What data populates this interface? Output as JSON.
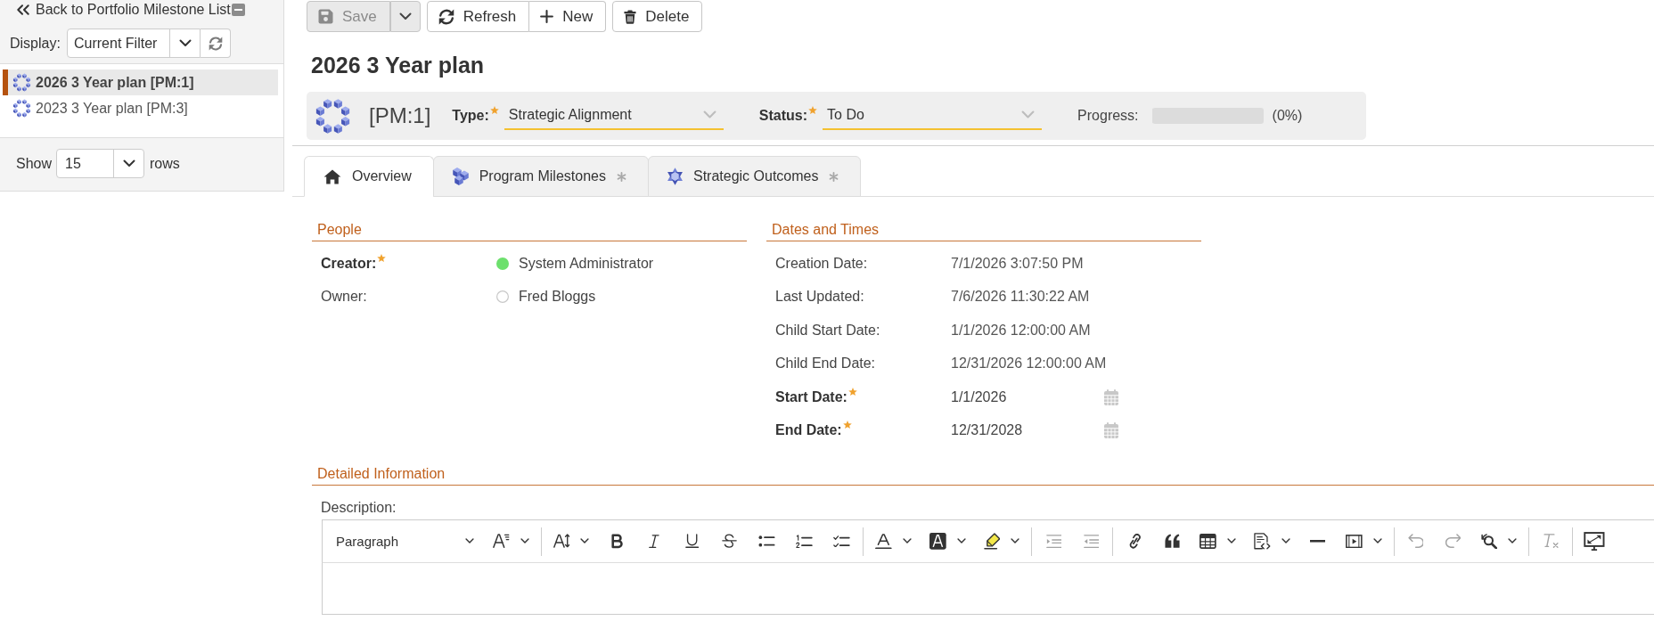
{
  "sidebar": {
    "back_link": "Back to Portfolio Milestone List",
    "display": {
      "label": "Display:",
      "value": "Current Filter"
    },
    "items": [
      {
        "label": "2026 3 Year plan [PM:1]",
        "selected": true
      },
      {
        "label": "2023 3 Year plan [PM:3]",
        "selected": false
      }
    ],
    "page_size": {
      "label": "Show",
      "value": "15",
      "unit": "rows"
    }
  },
  "toolbar": [
    [
      {
        "label": "Save",
        "kind": "save",
        "disabled": true
      }
    ],
    [
      {
        "label": "Refresh",
        "kind": "refresh",
        "disabled": false
      },
      {
        "label": "New",
        "kind": "new",
        "disabled": false
      }
    ],
    [
      {
        "label": "Delete",
        "kind": "delete",
        "disabled": false
      }
    ]
  ],
  "title": "2026 3 Year plan",
  "header": {
    "code": "[PM:1]",
    "fields": [
      {
        "label": "Type:",
        "value": "Strategic Alignment",
        "required": true
      },
      {
        "label": "Status:",
        "value": "To Do",
        "required": true
      }
    ],
    "progress": {
      "label": "Progress:",
      "level": 0,
      "reading": "(0%)"
    }
  },
  "tabs": [
    {
      "label": "Overview",
      "kind": "home",
      "selected": true,
      "marked": false
    },
    {
      "label": "Program Milestones",
      "kind": "milestones",
      "selected": false,
      "marked": true
    },
    {
      "label": "Strategic Outcomes",
      "kind": "outcomes",
      "selected": false,
      "marked": true
    }
  ],
  "people": {
    "title": "People",
    "rows": [
      {
        "label": "Creator:",
        "value": "System Administrator",
        "required": true,
        "kind": "person",
        "online": true
      },
      {
        "label": "Owner:",
        "value": "Fred Bloggs",
        "required": false,
        "kind": "person",
        "online": false
      }
    ]
  },
  "dates": {
    "title": "Dates and Times",
    "rows": [
      {
        "label": "Creation Date:",
        "value": "7/1/2026 3:07:50 PM",
        "required": false,
        "kind": "text"
      },
      {
        "label": "Last Updated:",
        "value": "7/6/2026 11:30:22 AM",
        "required": false,
        "kind": "text"
      },
      {
        "label": "Child Start Date:",
        "value": "1/1/2026 12:00:00 AM",
        "required": false,
        "kind": "text"
      },
      {
        "label": "Child End Date:",
        "value": "12/31/2026 12:00:00 AM",
        "required": false,
        "kind": "text"
      },
      {
        "label": "Start Date:",
        "value": "1/1/2026",
        "required": true,
        "kind": "date"
      },
      {
        "label": "End Date:",
        "value": "12/31/2028",
        "required": true,
        "kind": "date"
      }
    ]
  },
  "details": {
    "title": "Detailed Information",
    "description_label": "Description:",
    "editor_toolbar": [
      [
        {
          "kind": "heading",
          "label": "Paragraph",
          "disabled": false
        },
        {
          "kind": "fontfamily",
          "disabled": false
        }
      ],
      [
        {
          "kind": "fontsize",
          "disabled": false
        },
        {
          "kind": "bold",
          "disabled": false
        },
        {
          "kind": "italic",
          "disabled": false
        },
        {
          "kind": "underline",
          "disabled": false
        },
        {
          "kind": "strikethrough",
          "disabled": false
        },
        {
          "kind": "bullets",
          "disabled": false
        },
        {
          "kind": "numbering",
          "disabled": false
        },
        {
          "kind": "checklist",
          "disabled": false
        }
      ],
      [
        {
          "kind": "fontcolor",
          "disabled": false
        },
        {
          "kind": "background",
          "disabled": false
        },
        {
          "kind": "highlight",
          "disabled": false
        }
      ],
      [
        {
          "kind": "indent",
          "disabled": true
        },
        {
          "kind": "outdent",
          "disabled": true
        }
      ],
      [
        {
          "kind": "link",
          "disabled": false
        },
        {
          "kind": "quote",
          "disabled": false
        },
        {
          "kind": "table",
          "disabled": false
        },
        {
          "kind": "embed",
          "disabled": false
        },
        {
          "kind": "rule",
          "disabled": false
        },
        {
          "kind": "media",
          "disabled": false
        }
      ],
      [
        {
          "kind": "undo",
          "disabled": true
        },
        {
          "kind": "redo",
          "disabled": true
        },
        {
          "kind": "find",
          "disabled": false
        }
      ],
      [
        {
          "kind": "clearformat",
          "disabled": true
        }
      ],
      [
        {
          "kind": "preview",
          "disabled": false
        }
      ]
    ]
  }
}
